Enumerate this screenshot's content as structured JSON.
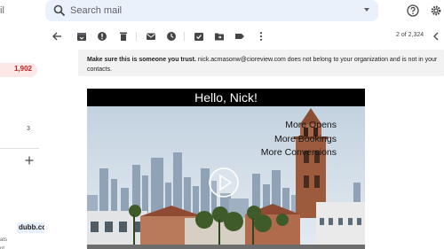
{
  "topbar": {
    "brand_fragment": "il",
    "search_placeholder": "Search mail"
  },
  "sidebar": {
    "inbox_count": "1,902",
    "small_count": "3",
    "chip_label": "dubb.com",
    "mini_text_1": "ats",
    "mini_text_2": "nt"
  },
  "toolbar": {
    "page_count": "2 of 2,324"
  },
  "message": {
    "trust_bold": "Make sure this is someone you trust.",
    "trust_text": " nick.acmasonw@cioreview.com does not belong to your organization and is not in your contacts.",
    "hero_title": "Hello, Nick!",
    "features": [
      "More Opens",
      "More Bookings",
      "More Conversions"
    ]
  },
  "colors": {
    "search_bg": "#eaf1fb",
    "count_pill_bg": "#fce8e6",
    "count_pill_text": "#c5221f",
    "banner_bg": "#f2f2f2"
  }
}
